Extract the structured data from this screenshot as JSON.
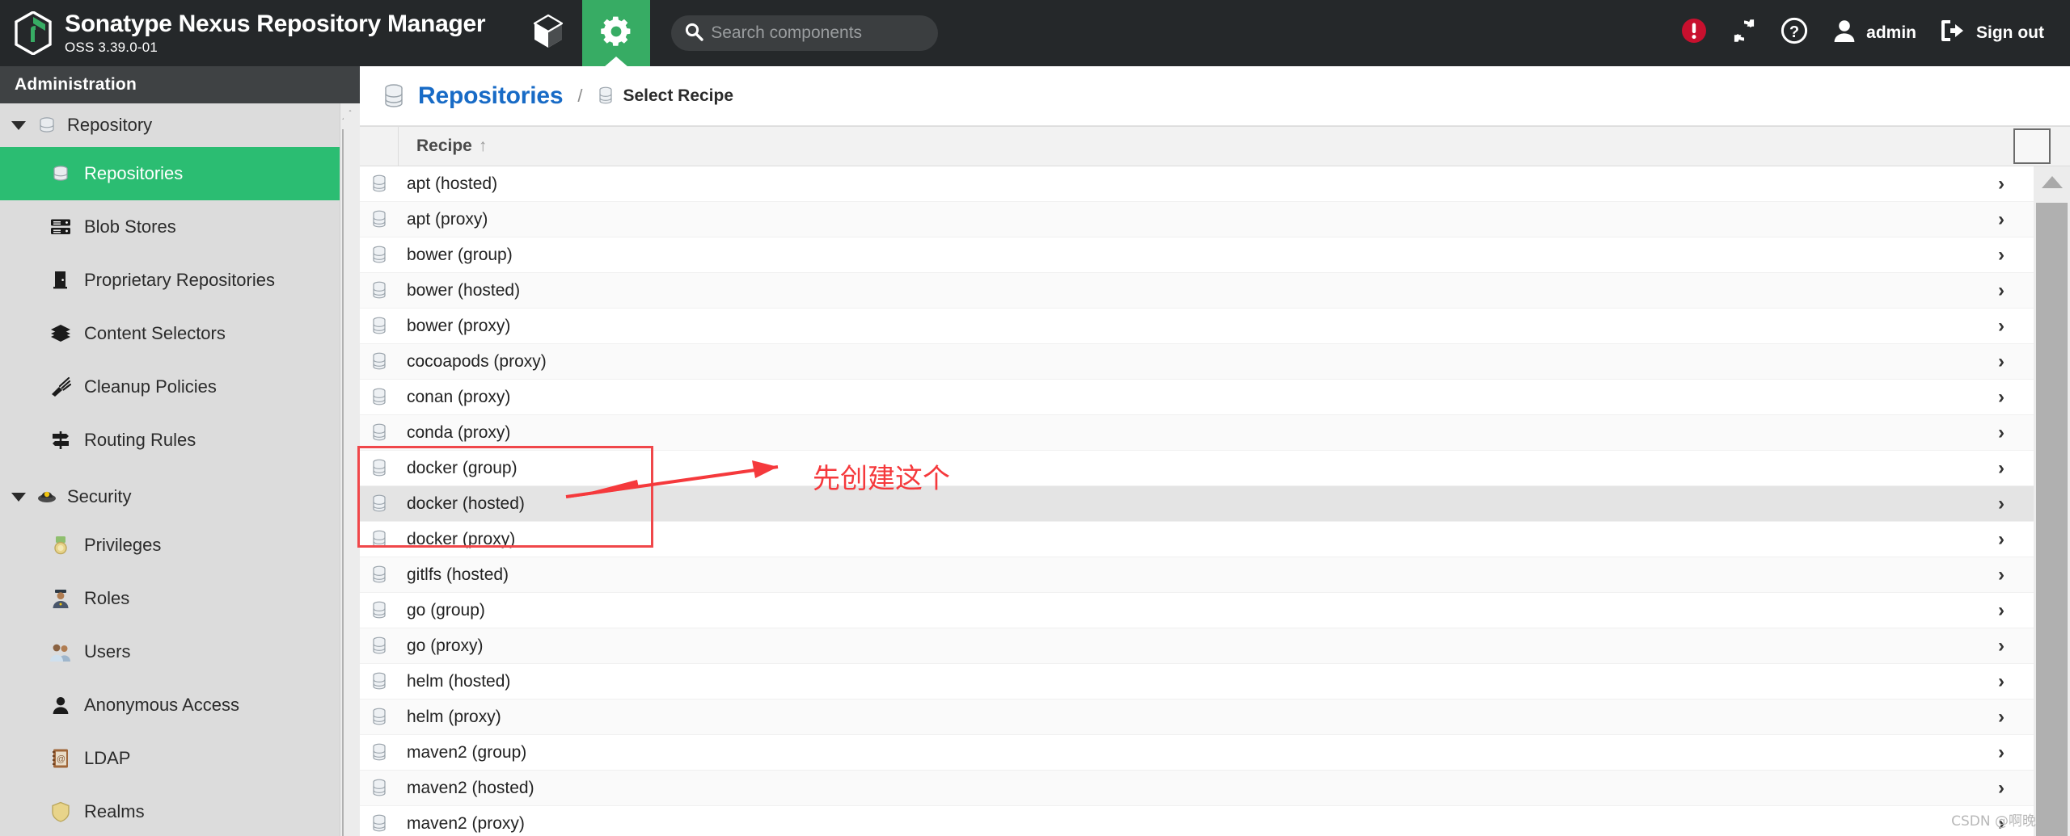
{
  "header": {
    "brand_title": "Sonatype Nexus Repository Manager",
    "brand_version": "OSS 3.39.0-01",
    "tabs": [
      {
        "name": "browse",
        "icon": "cube-icon",
        "active": false
      },
      {
        "name": "admin",
        "icon": "gear-icon",
        "active": true
      }
    ],
    "search_placeholder": "Search components",
    "search_value": "",
    "alert_icon": "alert-circle-icon",
    "refresh_icon": "refresh-icon",
    "help_icon": "help-circle-icon",
    "user_icon": "user-icon",
    "user_label": "admin",
    "signout_icon": "signout-icon",
    "signout_label": "Sign out",
    "accent_green": "#37ac64",
    "bar_background": "#25282a",
    "alert_red": "#c8102e"
  },
  "sidebar": {
    "title": "Administration",
    "groups": [
      {
        "label": "Repository",
        "icon": "database-icon",
        "expanded": true,
        "items": [
          {
            "label": "Repositories",
            "icon": "database-icon",
            "active": true
          },
          {
            "label": "Blob Stores",
            "icon": "server-icon",
            "active": false
          },
          {
            "label": "Proprietary Repositories",
            "icon": "door-icon",
            "active": false
          },
          {
            "label": "Content Selectors",
            "icon": "layers-icon",
            "active": false
          },
          {
            "label": "Cleanup Policies",
            "icon": "broom-icon",
            "active": false
          },
          {
            "label": "Routing Rules",
            "icon": "signpost-icon",
            "active": false
          }
        ]
      },
      {
        "label": "Security",
        "icon": "security-icon",
        "expanded": true,
        "items": [
          {
            "label": "Privileges",
            "icon": "medal-icon",
            "active": false
          },
          {
            "label": "Roles",
            "icon": "officer-icon",
            "active": false
          },
          {
            "label": "Users",
            "icon": "users-icon",
            "active": false
          },
          {
            "label": "Anonymous Access",
            "icon": "person-icon",
            "active": false
          },
          {
            "label": "LDAP",
            "icon": "address-book-icon",
            "active": false
          },
          {
            "label": "Realms",
            "icon": "shield-icon",
            "active": false
          }
        ]
      }
    ],
    "active_highlight": "#2bbd72"
  },
  "breadcrumb": {
    "root_icon": "database-icon",
    "root": "Repositories",
    "separator": "/",
    "current_icon": "database-icon",
    "current": "Select Recipe",
    "link_color": "#186bc6"
  },
  "grid": {
    "columns": [
      {
        "key": "recipe",
        "label": "Recipe",
        "sort": "↑"
      }
    ],
    "rows": [
      {
        "icon": "database-icon",
        "recipe": "apt (hosted)",
        "chevron": "›",
        "selected": false
      },
      {
        "icon": "database-icon",
        "recipe": "apt (proxy)",
        "chevron": "›",
        "selected": false
      },
      {
        "icon": "database-icon",
        "recipe": "bower (group)",
        "chevron": "›",
        "selected": false
      },
      {
        "icon": "database-icon",
        "recipe": "bower (hosted)",
        "chevron": "›",
        "selected": false
      },
      {
        "icon": "database-icon",
        "recipe": "bower (proxy)",
        "chevron": "›",
        "selected": false
      },
      {
        "icon": "database-icon",
        "recipe": "cocoapods (proxy)",
        "chevron": "›",
        "selected": false
      },
      {
        "icon": "database-icon",
        "recipe": "conan (proxy)",
        "chevron": "›",
        "selected": false
      },
      {
        "icon": "database-icon",
        "recipe": "conda (proxy)",
        "chevron": "›",
        "selected": false
      },
      {
        "icon": "database-icon",
        "recipe": "docker (group)",
        "chevron": "›",
        "selected": false
      },
      {
        "icon": "database-icon",
        "recipe": "docker (hosted)",
        "chevron": "›",
        "selected": true
      },
      {
        "icon": "database-icon",
        "recipe": "docker (proxy)",
        "chevron": "›",
        "selected": false
      },
      {
        "icon": "database-icon",
        "recipe": "gitlfs (hosted)",
        "chevron": "›",
        "selected": false
      },
      {
        "icon": "database-icon",
        "recipe": "go (group)",
        "chevron": "›",
        "selected": false
      },
      {
        "icon": "database-icon",
        "recipe": "go (proxy)",
        "chevron": "›",
        "selected": false
      },
      {
        "icon": "database-icon",
        "recipe": "helm (hosted)",
        "chevron": "›",
        "selected": false
      },
      {
        "icon": "database-icon",
        "recipe": "helm (proxy)",
        "chevron": "›",
        "selected": false
      },
      {
        "icon": "database-icon",
        "recipe": "maven2 (group)",
        "chevron": "›",
        "selected": false
      },
      {
        "icon": "database-icon",
        "recipe": "maven2 (hosted)",
        "chevron": "›",
        "selected": false
      },
      {
        "icon": "database-icon",
        "recipe": "maven2 (proxy)",
        "chevron": "›",
        "selected": false
      }
    ]
  },
  "annotation": {
    "text": "先创建这个",
    "color": "#f5393c",
    "box_color": "#f0474a"
  },
  "watermark": "CSDN @啊晚"
}
